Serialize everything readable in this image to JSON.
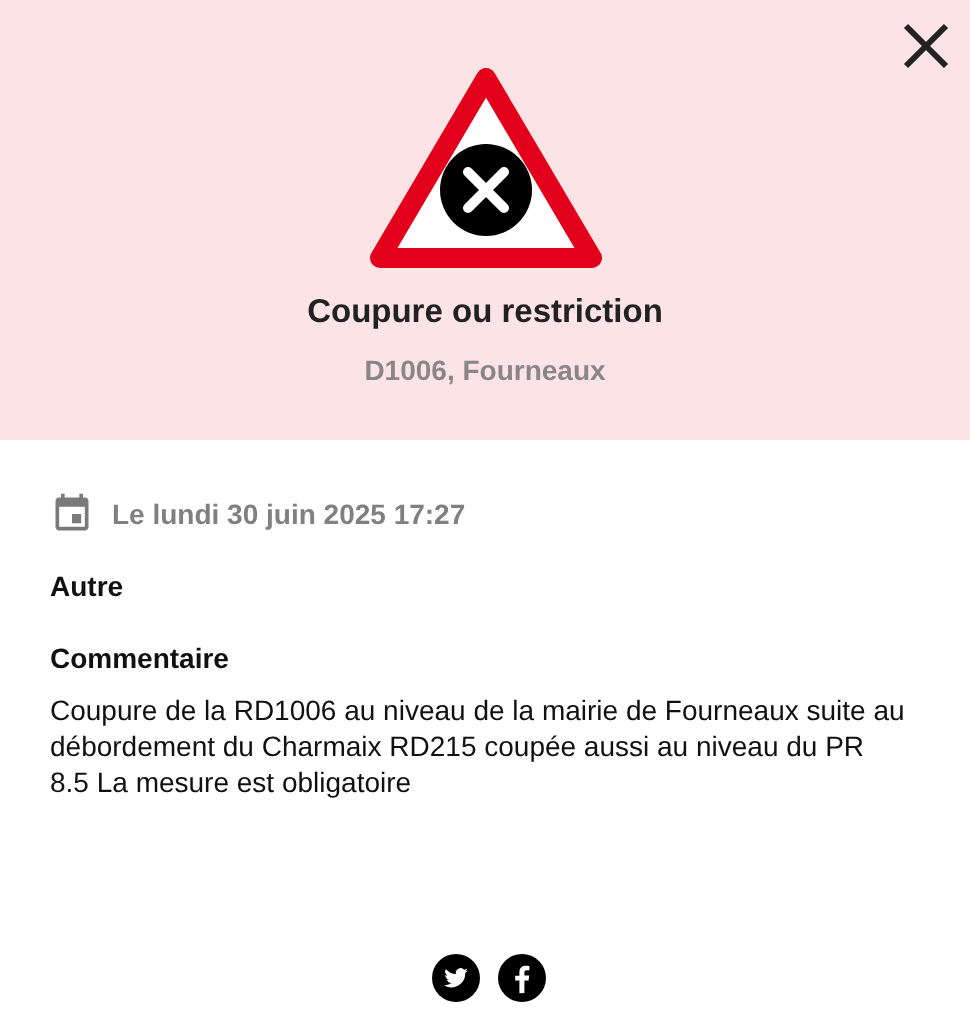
{
  "header": {
    "title": "Coupure ou restriction",
    "location": "D1006, Fourneaux"
  },
  "date": "Le lundi 30 juin 2025 17:27",
  "category": "Autre",
  "comment": {
    "heading": "Commentaire",
    "text": "Coupure de la RD1006 au niveau de la mairie de Fourneaux suite au débordement du Charmaix RD215 coupée aussi au niveau du PR 8.5 La mesure est obligatoire"
  },
  "share": [
    {
      "kind": "twitter"
    },
    {
      "kind": "facebook"
    }
  ]
}
